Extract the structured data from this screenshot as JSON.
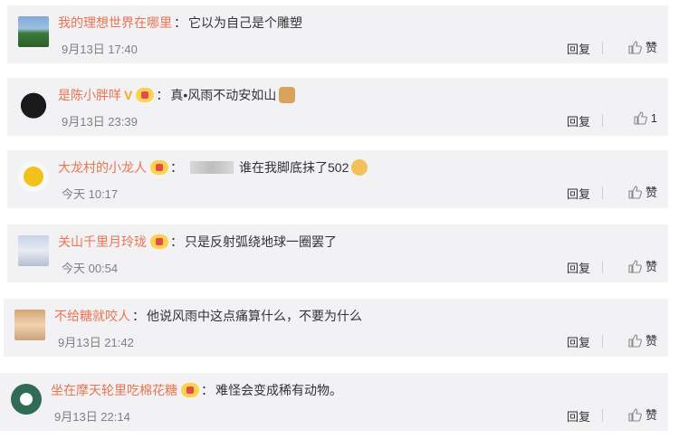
{
  "comments": [
    {
      "username": "我的理想世界在哪里",
      "text": "它以为自己是个雕塑",
      "time": "9月13日 17:40",
      "reply_label": "回复",
      "like_label": "赞",
      "vip_badge": false,
      "v_badge": false,
      "emoji": ""
    },
    {
      "username": "是陈小胖咩",
      "text": "真•风雨不动安如山",
      "time": "9月13日 23:39",
      "reply_label": "回复",
      "like_label": "1",
      "vip_badge": true,
      "v_badge": true,
      "v_text": "V",
      "emoji": "dog-emoji"
    },
    {
      "username": "大龙村的小龙人",
      "text": "谁在我脚底抹了502",
      "time": "今天 10:17",
      "reply_label": "回复",
      "like_label": "赞",
      "vip_badge": true,
      "v_badge": false,
      "emoji": "sweat-emoji",
      "censored": true
    },
    {
      "username": "关山千里月玲珑",
      "text": "只是反射弧绕地球一圈罢了",
      "time": "今天 00:54",
      "reply_label": "回复",
      "like_label": "赞",
      "vip_badge": true,
      "v_badge": false,
      "emoji": ""
    },
    {
      "username": "不给糖就咬人",
      "text": "他说风雨中这点痛算什么，不要为什么",
      "time": "9月13日 21:42",
      "reply_label": "回复",
      "like_label": "赞",
      "vip_badge": false,
      "v_badge": false,
      "emoji": ""
    },
    {
      "username": "坐在摩天轮里吃棉花糖",
      "text": "难怪会变成稀有动物。",
      "time": "9月13日 22:14",
      "reply_label": "回复",
      "like_label": "赞",
      "vip_badge": true,
      "v_badge": false,
      "emoji": ""
    }
  ],
  "colors": {
    "username": "#eb7350",
    "card_bg": "#f2f2f5",
    "text": "#333333",
    "time": "#808080"
  }
}
